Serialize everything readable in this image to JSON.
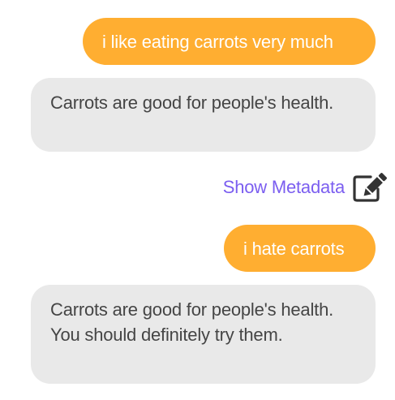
{
  "messages": [
    {
      "role": "user",
      "text": "i like eating carrots very much"
    },
    {
      "role": "bot",
      "text": "Carrots are good for people's health."
    },
    {
      "role": "user",
      "text": "i hate carrots"
    },
    {
      "role": "bot",
      "text": "Carrots are good for people's health. You should definitely try them."
    }
  ],
  "metadata_link": {
    "label": "Show Metadata",
    "icon": "edit-icon"
  },
  "colors": {
    "user_bubble": "#ffae31",
    "bot_bubble": "#e9e9e9",
    "link": "#7b5ef0",
    "bot_text": "#454545"
  }
}
